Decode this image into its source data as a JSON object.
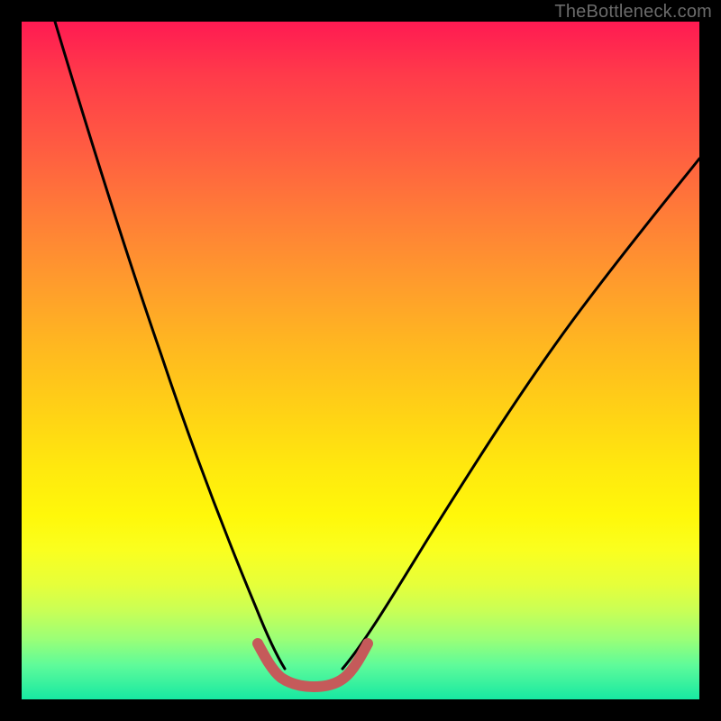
{
  "watermark": "TheBottleneck.com",
  "chart_data": {
    "type": "line",
    "title": "",
    "xlabel": "",
    "ylabel": "",
    "xlim": [
      0,
      100
    ],
    "ylim": [
      0,
      100
    ],
    "series": [
      {
        "name": "left-curve",
        "x": [
          5,
          8,
          11,
          14,
          17,
          20,
          23,
          26,
          29,
          32,
          34.5,
          37
        ],
        "y": [
          100,
          90,
          80,
          70,
          60,
          50,
          40,
          30,
          20,
          12,
          7,
          4
        ]
      },
      {
        "name": "right-curve",
        "x": [
          46,
          50,
          54,
          58,
          62,
          66,
          70,
          75,
          80,
          85,
          90,
          95,
          100
        ],
        "y": [
          4,
          7,
          11,
          16,
          21,
          27,
          33,
          40,
          48,
          56,
          64,
          72,
          80
        ]
      },
      {
        "name": "bottom-highlight",
        "x": [
          34.5,
          36,
          37,
          38,
          40,
          42,
          44,
          46,
          47,
          48.5
        ],
        "y": [
          8,
          5,
          3.5,
          3,
          2.8,
          2.8,
          3,
          3.5,
          5,
          8
        ]
      }
    ],
    "colors": {
      "curve": "#000000",
      "highlight": "#c55a5a",
      "gradient_top": "#ff1a52",
      "gradient_bottom": "#17e8a2"
    }
  }
}
